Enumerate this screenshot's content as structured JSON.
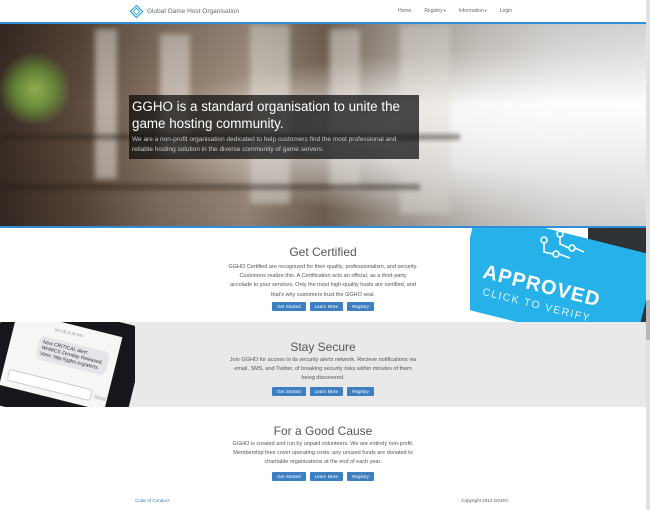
{
  "brand": {
    "name": "Global Game Host Organisation",
    "logo_icon": "diamond-logo-icon"
  },
  "nav": {
    "items": [
      {
        "label": "Home"
      },
      {
        "label": "Registry"
      },
      {
        "label": "Information"
      },
      {
        "label": "Login"
      }
    ],
    "dropdown_caret": "▾"
  },
  "hero": {
    "title": "GGHO is a standard organisation to unite the game hosting community.",
    "subtitle": "We are a non-profit organisation dedicated to help customers find the most professional and reliable hosting solution in the diverse community of game servers."
  },
  "sections": [
    {
      "title": "Get Certified",
      "body": "GGHO Certified are recognized for their quality, professionalism, and security. Customers realize this. A Certification acts an official, as a third-party accolade to your services. Only the most high-quality hosts are certified, and that's why customers trust the GGHO seal.",
      "buttons": [
        "Get Started",
        "Learn More",
        "Registry"
      ]
    },
    {
      "title": "Stay Secure",
      "body": "Join GGHO for access to its security alerts network. Recieve notifications via email, SMS, and Twitter, of breaking security risks within minutes of them being discovered.",
      "buttons": [
        "Get Started",
        "Learn More",
        "Registry"
      ]
    },
    {
      "title": "For a Good Cause",
      "body": "GGHO is created and run by unpaid volunteers. We are entirely non-profit. Membership fees cover operating costs; any unused funds are donated to charitable organizations at the end of each year.",
      "buttons": [
        "Get Started",
        "Learn More",
        "Registry"
      ]
    }
  ],
  "badge": {
    "headline": "APPROVED",
    "subline": "CLICK TO VERIFY"
  },
  "phone": {
    "timestamp": "Jun 18, 6:34 PM",
    "message": "New CRITICAL alert: WHMCS Zeroday Released. View: http://ggho.org/alerts",
    "send_label": "Send"
  },
  "footer": {
    "link": "Code of Conduct",
    "copyright": "Copyright 2013 GGHO."
  },
  "colors": {
    "accent": "#2e8fd6",
    "button": "#3d7fc1",
    "badge": "#26b1e9"
  }
}
